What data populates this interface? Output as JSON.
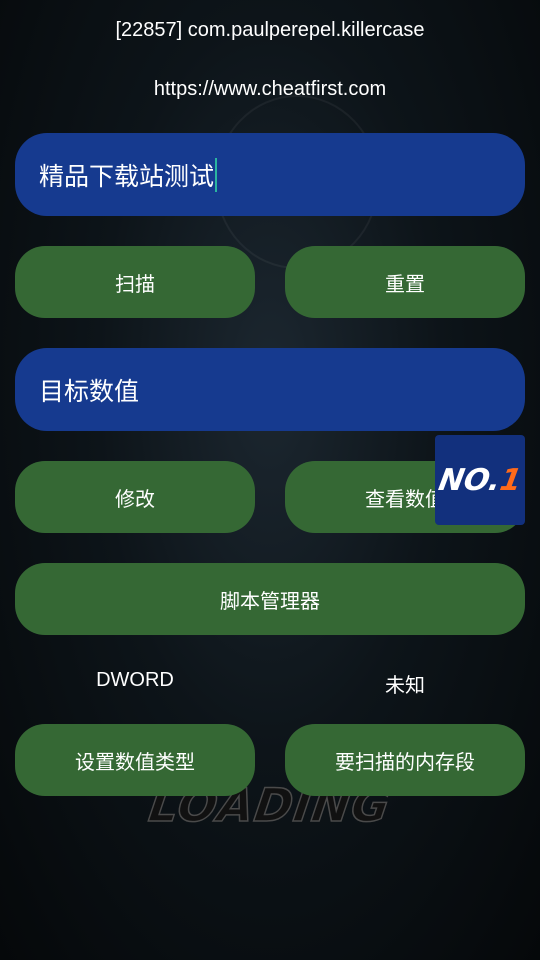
{
  "header": {
    "process_title": "[22857] com.paulperepel.killercase",
    "website": "https://www.cheatfirst.com"
  },
  "search_input": {
    "value": "精品下载站测试"
  },
  "buttons": {
    "scan": "扫描",
    "reset": "重置",
    "modify": "修改",
    "view_values": "查看数值",
    "script_manager": "脚本管理器",
    "set_value_type": "设置数值类型",
    "memory_segment": "要扫描的内存段"
  },
  "target_input": {
    "value": "目标数值"
  },
  "labels": {
    "value_type": "DWORD",
    "memory_region": "未知"
  },
  "badge": {
    "prefix": "NO.",
    "number": "1"
  },
  "background": {
    "loading_text": "LOADING"
  },
  "colors": {
    "input_bg": "#163a8f",
    "button_bg": "#356834",
    "badge_accent": "#ff6a1a"
  }
}
